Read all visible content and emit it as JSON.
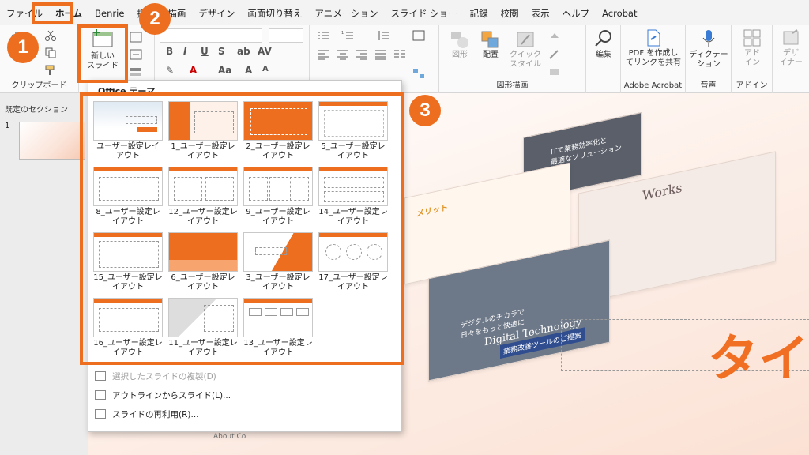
{
  "menu": {
    "tabs": [
      "ファイル",
      "ホーム",
      "Benrie",
      "挿入",
      "描画",
      "デザイン",
      "画面切り替え",
      "アニメーション",
      "スライド ショー",
      "記録",
      "校閲",
      "表示",
      "ヘルプ",
      "Acrobat"
    ]
  },
  "ribbon": {
    "clipboard_label": "クリップボード",
    "new_slide_label_1": "新しい",
    "new_slide_label_2": "スライド",
    "shapes_label": "図形",
    "arrange_label": "配置",
    "quick_style_1": "クイック",
    "quick_style_2": "スタイル",
    "drawing_label": "図形描画",
    "edit_label": "編集",
    "pdf_label_1": "PDF を作成し",
    "pdf_label_2": "てリンクを共有",
    "adobe_label": "Adobe Acrobat",
    "dictate_1": "ディクテー",
    "dictate_2": "ション",
    "voice_label": "音声",
    "addin_1": "アド",
    "addin_2": "イン",
    "addin_label": "アドイン",
    "designer_1": "デザ",
    "designer_2": "イナー"
  },
  "left_panel": {
    "section": "既定のセクション",
    "slide_number": "1"
  },
  "dropdown": {
    "header": "Office テーマ",
    "layouts": [
      {
        "name": "ユーザー設定レイアウト"
      },
      {
        "name": "1_ユーザー設定レイアウト"
      },
      {
        "name": "2_ユーザー設定レイアウト"
      },
      {
        "name": "5_ユーザー設定レイアウト"
      },
      {
        "name": "8_ユーザー設定レイアウト"
      },
      {
        "name": "12_ユーザー設定レイアウト"
      },
      {
        "name": "9_ユーザー設定レイアウト"
      },
      {
        "name": "14_ユーザー設定レイアウト"
      },
      {
        "name": "15_ユーザー設定レイアウト"
      },
      {
        "name": "6_ユーザー設定レイアウト"
      },
      {
        "name": "3_ユーザー設定レイアウト"
      },
      {
        "name": "17_ユーザー設定レイアウト"
      },
      {
        "name": "16_ユーザー設定レイアウト"
      },
      {
        "name": "11_ユーザー設定レイアウト"
      },
      {
        "name": "13_ユーザー設定レイアウト"
      }
    ],
    "menu_duplicate": "選択したスライドの複製(D)",
    "menu_outline": "アウトラインからスライド(L)...",
    "menu_reuse": "スライドの再利用(R)..."
  },
  "canvas": {
    "title_fragment": "タイ",
    "works": "Works",
    "digital": "Digital Technology",
    "solution_1": "ITで業務効率化と",
    "solution_2": "最適なソリューション",
    "service": "業務改善ツールのご提案",
    "catch": "デジタルのチカラで",
    "catch2": "日々をもっと快適に",
    "merit": "メリット",
    "about": "About Co"
  },
  "annotations": {
    "step1": "1",
    "step2": "2",
    "step3": "3"
  },
  "colors": {
    "accent": "#ee6e1f",
    "brand_orange": "#f06f22"
  }
}
